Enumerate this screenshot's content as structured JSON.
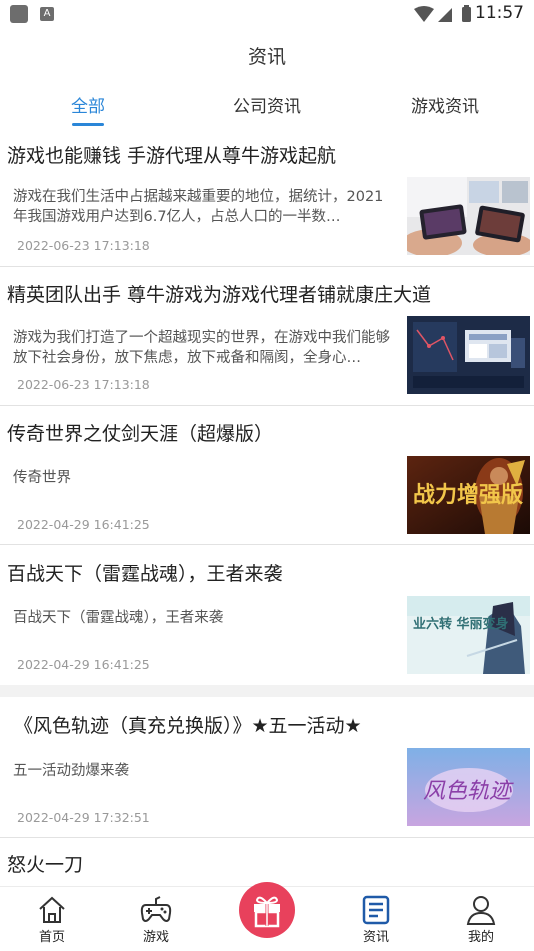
{
  "status_bar": {
    "time": "11:57",
    "a_badge": "A"
  },
  "header": {
    "title": "资讯"
  },
  "tabs": [
    {
      "label": "全部",
      "active": true
    },
    {
      "label": "公司资讯",
      "active": false
    },
    {
      "label": "游戏资讯",
      "active": false
    }
  ],
  "articles": [
    {
      "title": "游戏也能赚钱 手游代理从尊牛游戏起航",
      "summary": "游戏在我们生活中占据越来越重要的地位，据统计，2021年我国游戏用户达到6.7亿人，占总人口的一半数…",
      "date": "2022-06-23 17:13:18",
      "thumb": "phones-holding-icon"
    },
    {
      "title": "精英团队出手 尊牛游戏为游戏代理者铺就康庄大道",
      "summary": "游戏为我们打造了一个超越现实的世界，在游戏中我们能够放下社会身份，放下焦虑，放下戒备和隔阂，全身心…",
      "date": "2022-06-23 17:13:18",
      "thumb": "dashboard-screens-icon"
    },
    {
      "title": "传奇世界之仗剑天涯（超爆版）",
      "summary": "传奇世界",
      "date": "2022-04-29 16:41:25",
      "thumb": "warrior-banner-icon",
      "thumb_text": "战力增强版"
    },
    {
      "title": "百战天下（雷霆战魂），王者来袭",
      "summary": "百战天下（雷霆战魂），王者来袭",
      "date": "2022-04-29 16:41:25",
      "thumb": "swordsman-banner-icon",
      "thumb_text": "业六转 华丽变身"
    },
    {
      "title": "《风色轨迹（真充兑换版）》★五一活动★",
      "summary": "五一活动劲爆来袭",
      "date": "2022-04-29 17:32:51",
      "thumb": "fantasy-logo-icon",
      "thumb_text": "风色轨迹"
    },
    {
      "title": "怒火一刀",
      "summary": "",
      "date": ""
    }
  ],
  "bottom_nav": [
    {
      "label": "首页",
      "icon": "home-icon"
    },
    {
      "label": "游戏",
      "icon": "gamepad-icon"
    },
    {
      "label": "",
      "icon": "gift-icon"
    },
    {
      "label": "资讯",
      "icon": "news-icon"
    },
    {
      "label": "我的",
      "icon": "user-icon"
    }
  ],
  "colors": {
    "accent": "#2a86d8",
    "gift": "#e8415c",
    "text": "#222222",
    "muted": "#999999"
  }
}
